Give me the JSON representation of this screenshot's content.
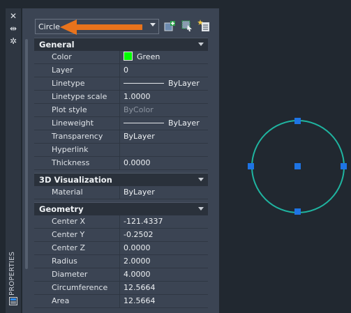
{
  "palette": {
    "title": "PROPERTIES",
    "object_type": "Circle",
    "sections": {
      "general": {
        "title": "General",
        "rows": [
          {
            "label": "Color",
            "value": "Green"
          },
          {
            "label": "Layer",
            "value": "0"
          },
          {
            "label": "Linetype",
            "value": "ByLayer"
          },
          {
            "label": "Linetype scale",
            "value": "1.0000"
          },
          {
            "label": "Plot style",
            "value": "ByColor"
          },
          {
            "label": "Lineweight",
            "value": "ByLayer"
          },
          {
            "label": "Transparency",
            "value": "ByLayer"
          },
          {
            "label": "Hyperlink",
            "value": ""
          },
          {
            "label": "Thickness",
            "value": "0.0000"
          }
        ]
      },
      "vis3d": {
        "title": "3D Visualization",
        "rows": [
          {
            "label": "Material",
            "value": "ByLayer"
          }
        ]
      },
      "geometry": {
        "title": "Geometry",
        "rows": [
          {
            "label": "Center X",
            "value": "-121.4337"
          },
          {
            "label": "Center Y",
            "value": "-0.2502"
          },
          {
            "label": "Center Z",
            "value": "0.0000"
          },
          {
            "label": "Radius",
            "value": "2.0000"
          },
          {
            "label": "Diameter",
            "value": "4.0000"
          },
          {
            "label": "Circumference",
            "value": "12.5664"
          },
          {
            "label": "Area",
            "value": "12.5664"
          }
        ]
      }
    }
  },
  "colors": {
    "circle_stroke": "#1fb4a0",
    "grip": "#1e74e4",
    "arrow": "#e8731c",
    "swatch": "#00ff00"
  }
}
